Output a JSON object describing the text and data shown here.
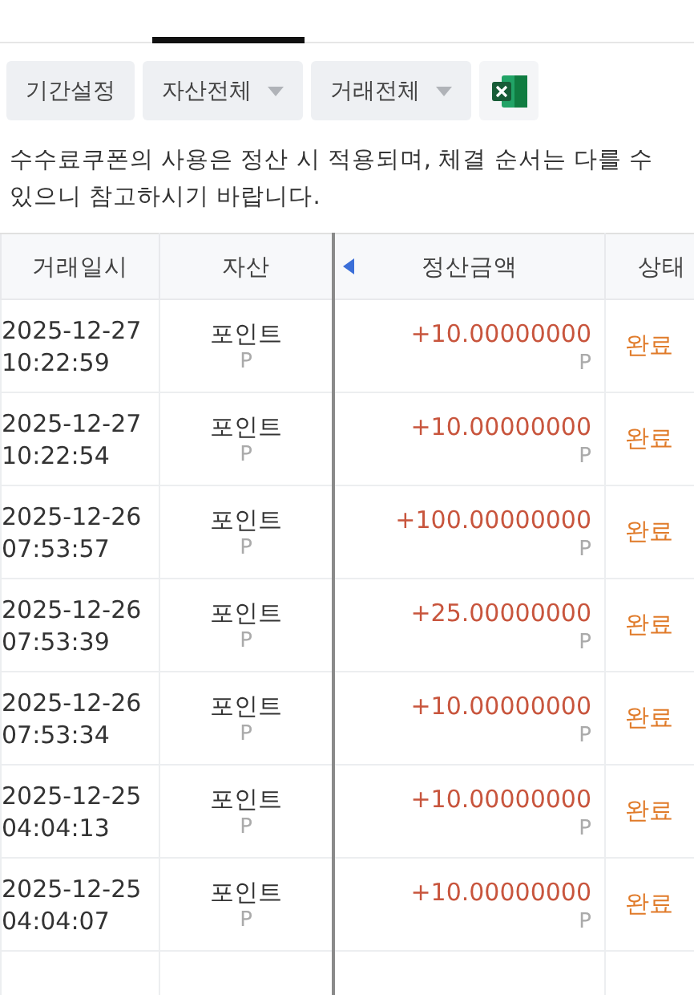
{
  "tabs": [
    {
      "selected": false
    },
    {
      "selected": true
    },
    {
      "selected": false
    },
    {
      "selected": false
    },
    {
      "selected": false
    }
  ],
  "filters": [
    {
      "kind": "button",
      "label": "기간설정"
    },
    {
      "kind": "dropdown",
      "label": "자산전체"
    },
    {
      "kind": "dropdown",
      "label": "거래전체"
    },
    {
      "kind": "excel"
    }
  ],
  "notice": "수수료쿠폰의 사용은 정산 시 적용되며, 체결 순서는 다를 수 있으니 참고하시기 바랍니다.",
  "table": {
    "columns": [
      "거래일시",
      "자산",
      "정산금액",
      "상태"
    ],
    "rows": [
      {
        "date": "2025-12-27",
        "time": "10:22:59",
        "asset": "포인트",
        "asset_unit": "P",
        "amount": "+10.00000000",
        "amount_unit": "P",
        "status": "완료"
      },
      {
        "date": "2025-12-27",
        "time": "10:22:54",
        "asset": "포인트",
        "asset_unit": "P",
        "amount": "+10.00000000",
        "amount_unit": "P",
        "status": "완료"
      },
      {
        "date": "2025-12-26",
        "time": "07:53:57",
        "asset": "포인트",
        "asset_unit": "P",
        "amount": "+100.00000000",
        "amount_unit": "P",
        "status": "완료"
      },
      {
        "date": "2025-12-26",
        "time": "07:53:39",
        "asset": "포인트",
        "asset_unit": "P",
        "amount": "+25.00000000",
        "amount_unit": "P",
        "status": "완료"
      },
      {
        "date": "2025-12-26",
        "time": "07:53:34",
        "asset": "포인트",
        "asset_unit": "P",
        "amount": "+10.00000000",
        "amount_unit": "P",
        "status": "완료"
      },
      {
        "date": "2025-12-25",
        "time": "04:04:13",
        "asset": "포인트",
        "asset_unit": "P",
        "amount": "+10.00000000",
        "amount_unit": "P",
        "status": "완료"
      },
      {
        "date": "2025-12-25",
        "time": "04:04:07",
        "asset": "포인트",
        "asset_unit": "P",
        "amount": "+10.00000000",
        "amount_unit": "P",
        "status": "완료"
      }
    ]
  }
}
